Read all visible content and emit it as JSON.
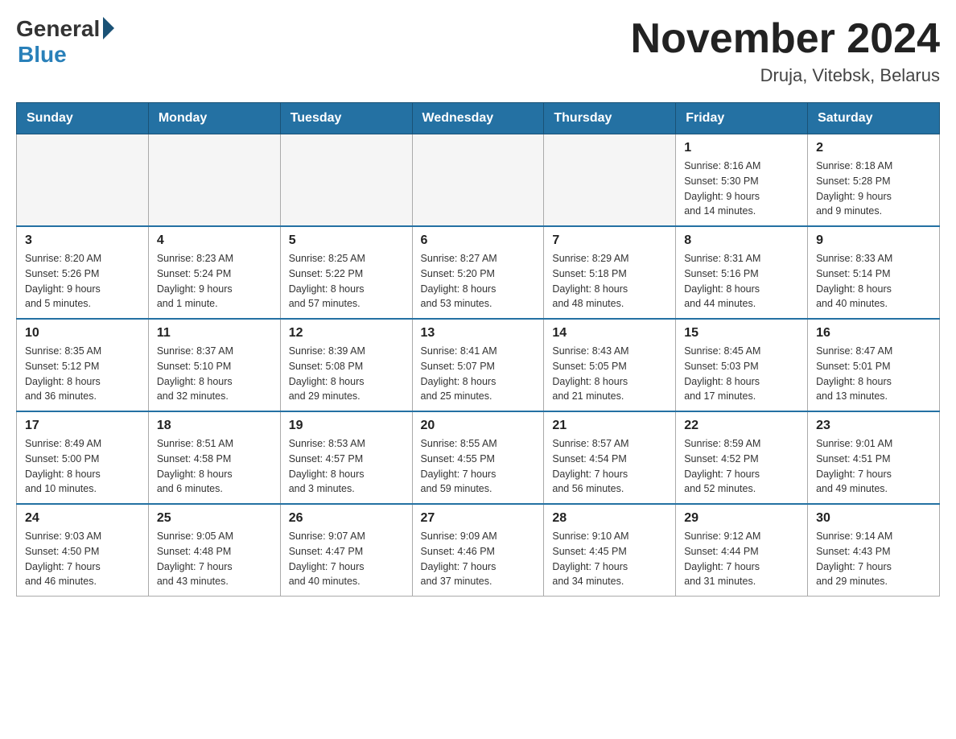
{
  "logo": {
    "general": "General",
    "blue": "Blue"
  },
  "title": "November 2024",
  "location": "Druja, Vitebsk, Belarus",
  "weekdays": [
    "Sunday",
    "Monday",
    "Tuesday",
    "Wednesday",
    "Thursday",
    "Friday",
    "Saturday"
  ],
  "weeks": [
    [
      {
        "day": "",
        "info": ""
      },
      {
        "day": "",
        "info": ""
      },
      {
        "day": "",
        "info": ""
      },
      {
        "day": "",
        "info": ""
      },
      {
        "day": "",
        "info": ""
      },
      {
        "day": "1",
        "info": "Sunrise: 8:16 AM\nSunset: 5:30 PM\nDaylight: 9 hours\nand 14 minutes."
      },
      {
        "day": "2",
        "info": "Sunrise: 8:18 AM\nSunset: 5:28 PM\nDaylight: 9 hours\nand 9 minutes."
      }
    ],
    [
      {
        "day": "3",
        "info": "Sunrise: 8:20 AM\nSunset: 5:26 PM\nDaylight: 9 hours\nand 5 minutes."
      },
      {
        "day": "4",
        "info": "Sunrise: 8:23 AM\nSunset: 5:24 PM\nDaylight: 9 hours\nand 1 minute."
      },
      {
        "day": "5",
        "info": "Sunrise: 8:25 AM\nSunset: 5:22 PM\nDaylight: 8 hours\nand 57 minutes."
      },
      {
        "day": "6",
        "info": "Sunrise: 8:27 AM\nSunset: 5:20 PM\nDaylight: 8 hours\nand 53 minutes."
      },
      {
        "day": "7",
        "info": "Sunrise: 8:29 AM\nSunset: 5:18 PM\nDaylight: 8 hours\nand 48 minutes."
      },
      {
        "day": "8",
        "info": "Sunrise: 8:31 AM\nSunset: 5:16 PM\nDaylight: 8 hours\nand 44 minutes."
      },
      {
        "day": "9",
        "info": "Sunrise: 8:33 AM\nSunset: 5:14 PM\nDaylight: 8 hours\nand 40 minutes."
      }
    ],
    [
      {
        "day": "10",
        "info": "Sunrise: 8:35 AM\nSunset: 5:12 PM\nDaylight: 8 hours\nand 36 minutes."
      },
      {
        "day": "11",
        "info": "Sunrise: 8:37 AM\nSunset: 5:10 PM\nDaylight: 8 hours\nand 32 minutes."
      },
      {
        "day": "12",
        "info": "Sunrise: 8:39 AM\nSunset: 5:08 PM\nDaylight: 8 hours\nand 29 minutes."
      },
      {
        "day": "13",
        "info": "Sunrise: 8:41 AM\nSunset: 5:07 PM\nDaylight: 8 hours\nand 25 minutes."
      },
      {
        "day": "14",
        "info": "Sunrise: 8:43 AM\nSunset: 5:05 PM\nDaylight: 8 hours\nand 21 minutes."
      },
      {
        "day": "15",
        "info": "Sunrise: 8:45 AM\nSunset: 5:03 PM\nDaylight: 8 hours\nand 17 minutes."
      },
      {
        "day": "16",
        "info": "Sunrise: 8:47 AM\nSunset: 5:01 PM\nDaylight: 8 hours\nand 13 minutes."
      }
    ],
    [
      {
        "day": "17",
        "info": "Sunrise: 8:49 AM\nSunset: 5:00 PM\nDaylight: 8 hours\nand 10 minutes."
      },
      {
        "day": "18",
        "info": "Sunrise: 8:51 AM\nSunset: 4:58 PM\nDaylight: 8 hours\nand 6 minutes."
      },
      {
        "day": "19",
        "info": "Sunrise: 8:53 AM\nSunset: 4:57 PM\nDaylight: 8 hours\nand 3 minutes."
      },
      {
        "day": "20",
        "info": "Sunrise: 8:55 AM\nSunset: 4:55 PM\nDaylight: 7 hours\nand 59 minutes."
      },
      {
        "day": "21",
        "info": "Sunrise: 8:57 AM\nSunset: 4:54 PM\nDaylight: 7 hours\nand 56 minutes."
      },
      {
        "day": "22",
        "info": "Sunrise: 8:59 AM\nSunset: 4:52 PM\nDaylight: 7 hours\nand 52 minutes."
      },
      {
        "day": "23",
        "info": "Sunrise: 9:01 AM\nSunset: 4:51 PM\nDaylight: 7 hours\nand 49 minutes."
      }
    ],
    [
      {
        "day": "24",
        "info": "Sunrise: 9:03 AM\nSunset: 4:50 PM\nDaylight: 7 hours\nand 46 minutes."
      },
      {
        "day": "25",
        "info": "Sunrise: 9:05 AM\nSunset: 4:48 PM\nDaylight: 7 hours\nand 43 minutes."
      },
      {
        "day": "26",
        "info": "Sunrise: 9:07 AM\nSunset: 4:47 PM\nDaylight: 7 hours\nand 40 minutes."
      },
      {
        "day": "27",
        "info": "Sunrise: 9:09 AM\nSunset: 4:46 PM\nDaylight: 7 hours\nand 37 minutes."
      },
      {
        "day": "28",
        "info": "Sunrise: 9:10 AM\nSunset: 4:45 PM\nDaylight: 7 hours\nand 34 minutes."
      },
      {
        "day": "29",
        "info": "Sunrise: 9:12 AM\nSunset: 4:44 PM\nDaylight: 7 hours\nand 31 minutes."
      },
      {
        "day": "30",
        "info": "Sunrise: 9:14 AM\nSunset: 4:43 PM\nDaylight: 7 hours\nand 29 minutes."
      }
    ]
  ]
}
